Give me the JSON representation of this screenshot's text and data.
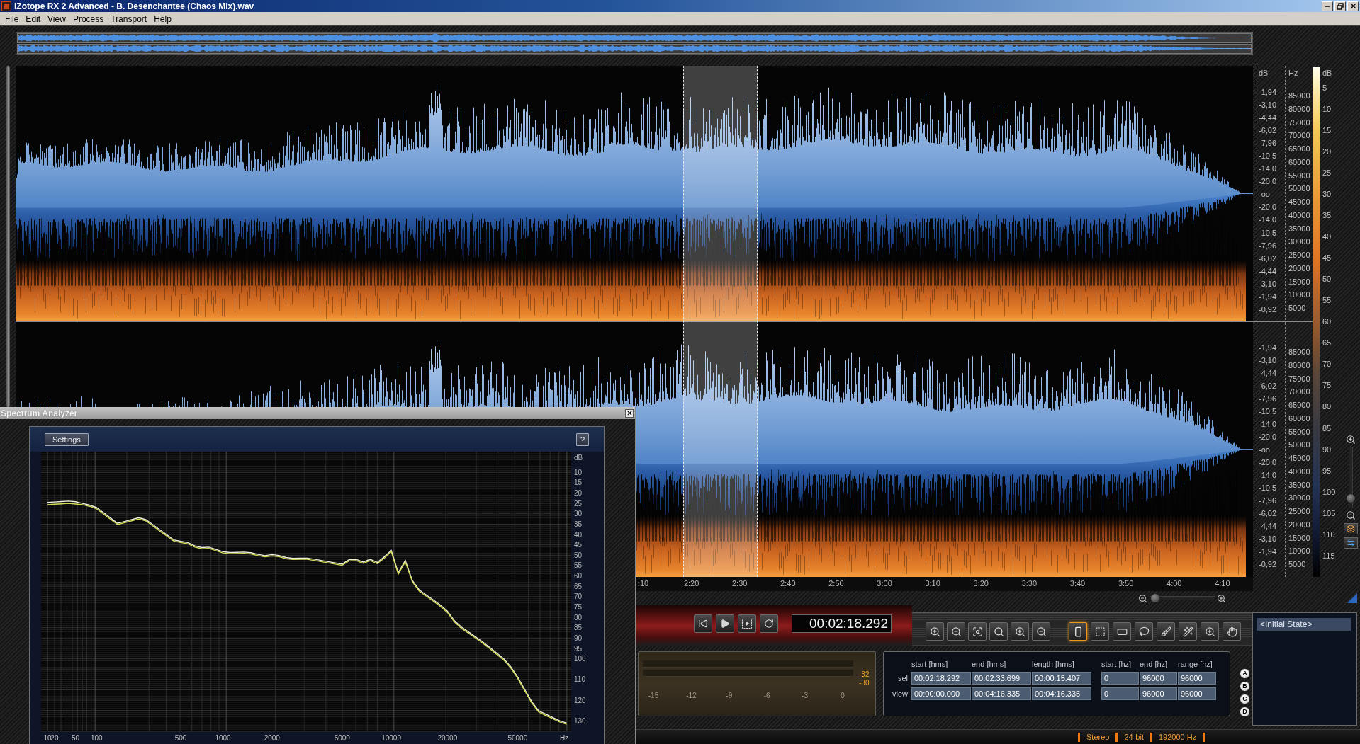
{
  "window": {
    "title": "iZotope RX 2 Advanced - B. Desenchantee (Chaos Mix).wav"
  },
  "menu": [
    "File",
    "Edit",
    "View",
    "Process",
    "Transport",
    "Help"
  ],
  "amplitude_axis": {
    "unit": "dB",
    "channels": [
      [
        "-1,94",
        "-3,10",
        "-4,44",
        "-6,02",
        "-7,96",
        "-10,5",
        "-14,0",
        "-20,0",
        "-oo",
        "-20,0",
        "-14,0",
        "-10,5",
        "-7,96",
        "-6,02",
        "-4,44",
        "-3,10",
        "-1,94",
        "-0,92"
      ],
      [
        "-1,94",
        "-3,10",
        "-4,44",
        "-6,02",
        "-7,96",
        "-10,5",
        "-14,0",
        "-20,0",
        "-oo",
        "-20,0",
        "-14,0",
        "-10,5",
        "-7,96",
        "-6,02",
        "-4,44",
        "-3,10",
        "-1,94",
        "-0,92"
      ]
    ]
  },
  "frequency_axis": {
    "unit": "Hz",
    "channels": [
      [
        "85000",
        "80000",
        "75000",
        "70000",
        "65000",
        "60000",
        "55000",
        "50000",
        "45000",
        "40000",
        "35000",
        "30000",
        "25000",
        "20000",
        "15000",
        "10000",
        "5000"
      ],
      [
        "85000",
        "80000",
        "75000",
        "70000",
        "65000",
        "60000",
        "55000",
        "50000",
        "45000",
        "40000",
        "35000",
        "30000",
        "25000",
        "20000",
        "15000",
        "10000",
        "5000"
      ]
    ]
  },
  "color_scale": {
    "unit": "dB",
    "labels": [
      "5",
      "10",
      "15",
      "20",
      "25",
      "30",
      "35",
      "40",
      "45",
      "50",
      "55",
      "60",
      "65",
      "70",
      "75",
      "80",
      "85",
      "90",
      "95",
      "100",
      "105",
      "110",
      "115"
    ]
  },
  "frequency_zoom": {
    "level": 0.1
  },
  "time_axis": {
    "labels": [
      ":10",
      "2:20",
      "2:30",
      "2:40",
      "2:50",
      "3:00",
      "3:10",
      "3:20",
      "3:30",
      "3:40",
      "3:50",
      "4:00",
      "4:10"
    ]
  },
  "time_zoom": {
    "level": 0.03
  },
  "transport": {
    "time": "00:02:18.292"
  },
  "selection_tools": [
    {
      "selected": true
    },
    {
      "selected": false
    },
    {
      "selected": false
    },
    {
      "selected": false
    },
    {
      "selected": false
    },
    {
      "selected": false
    },
    {
      "selected": false
    },
    {
      "selected": false
    }
  ],
  "meter": {
    "scale": [
      "-15",
      "-12",
      "-9",
      "-6",
      "-3",
      "0"
    ],
    "peaks": [
      "-32",
      "-30"
    ]
  },
  "selection_info": {
    "columns": [
      "start [hms]",
      "end [hms]",
      "length [hms]",
      "start [hz]",
      "end [hz]",
      "range [hz]"
    ],
    "rows": [
      {
        "label": "sel",
        "cells": [
          "00:02:18.292",
          "00:02:33.699",
          "00:00:15.407",
          "0",
          "96000",
          "96000"
        ]
      },
      {
        "label": "view",
        "cells": [
          "00:00:00.000",
          "00:04:16.335",
          "00:04:16.335",
          "0",
          "96000",
          "96000"
        ]
      }
    ]
  },
  "snapshots": [
    "A",
    "B",
    "C",
    "D"
  ],
  "history": [
    {
      "label": "<Initial State>",
      "selected": true
    }
  ],
  "status_bar": [
    "Stereo",
    "24-bit",
    "192000 Hz"
  ],
  "spectrum_analyzer": {
    "title": "Spectrum Analyzer",
    "settings_button": "Settings",
    "help_button": "?",
    "chart_data": {
      "type": "line",
      "xlabel": "Hz",
      "ylabel": "dB",
      "grid": true,
      "categories": [
        "10",
        "20",
        null,
        null,
        "50",
        null,
        null,
        "100",
        null,
        null,
        null,
        null,
        null,
        null,
        null,
        null,
        null,
        null,
        null,
        "500",
        null,
        null,
        null,
        null,
        null,
        "1000",
        null,
        null,
        null,
        null,
        null,
        null,
        "2000",
        null,
        null,
        null,
        null,
        null,
        null,
        null,
        null,
        null,
        "5000",
        null,
        null,
        null,
        null,
        null,
        null,
        "10000",
        null,
        null,
        null,
        null,
        null,
        null,
        null,
        "20000",
        null,
        null,
        null,
        null,
        null,
        null,
        null,
        null,
        null,
        "50000",
        null,
        null,
        null,
        null,
        null,
        null,
        null
      ],
      "series": [
        {
          "color": "#eeeedd",
          "values": [
            24.5,
            24.3,
            24.1,
            23.9,
            24.2,
            25.0,
            25.8,
            27.0,
            29.5,
            32.1,
            34.6,
            33.7,
            32.8,
            31.9,
            32.8,
            35.2,
            37.7,
            40.1,
            42.6,
            43.3,
            43.9,
            45.5,
            46.3,
            46.1,
            47.2,
            48.3,
            48.7,
            48.6,
            48.5,
            48.8,
            49.6,
            50.2,
            49.7,
            50.1,
            51.1,
            51.5,
            51.4,
            51.4,
            51.9,
            52.5,
            53.1,
            53.7,
            54.3,
            52.1,
            52.0,
            53.3,
            52.0,
            53.5,
            50.8,
            47.7,
            58.5,
            52.5,
            62.2,
            66.8,
            69.2,
            71.6,
            74.1,
            77.0,
            81.6,
            84.7,
            87.0,
            89.4,
            91.8,
            94.4,
            97.2,
            99.9,
            103.7,
            108.7,
            114.7,
            120.6,
            125.1,
            126.7,
            128.3,
            129.9,
            131.0
          ]
        },
        {
          "color": "#d4dd58",
          "values": [
            25.6,
            25.4,
            25.2,
            25.0,
            25.3,
            25.6,
            26.4,
            27.6,
            30.1,
            32.7,
            35.2,
            34.3,
            33.4,
            32.5,
            33.4,
            35.8,
            38.3,
            40.7,
            43.2,
            43.9,
            44.5,
            46.1,
            46.9,
            46.7,
            47.8,
            48.9,
            49.3,
            49.2,
            49.1,
            49.4,
            50.2,
            50.8,
            50.3,
            50.7,
            51.7,
            52.1,
            52.0,
            52.0,
            52.5,
            53.1,
            53.7,
            54.3,
            54.9,
            52.7,
            52.6,
            53.9,
            52.6,
            54.1,
            51.4,
            48.3,
            59.1,
            53.1,
            62.8,
            67.4,
            69.8,
            72.2,
            74.7,
            77.6,
            82.2,
            85.3,
            87.6,
            90.0,
            92.4,
            95.0,
            97.8,
            100.5,
            104.3,
            109.3,
            115.3,
            121.2,
            125.7,
            127.3,
            128.9,
            130.5,
            131.6
          ]
        }
      ],
      "ylim": [
        135,
        0
      ],
      "yticks": [
        10,
        15,
        20,
        25,
        30,
        35,
        40,
        45,
        50,
        55,
        60,
        65,
        70,
        75,
        80,
        85,
        90,
        95,
        100,
        110,
        120,
        130
      ]
    }
  }
}
